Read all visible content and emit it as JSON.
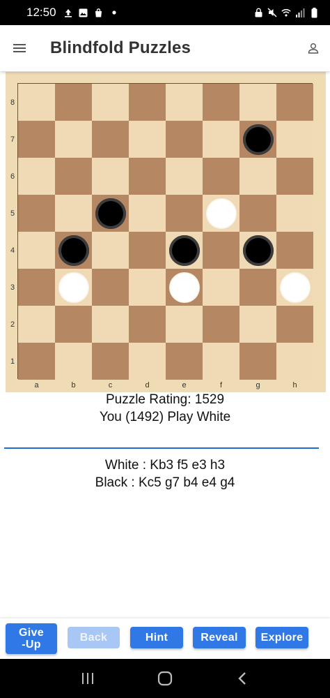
{
  "status_bar": {
    "time": "12:50",
    "left_icons": [
      "upload-icon",
      "image-icon",
      "bag-icon",
      "dot-icon"
    ],
    "right_icons": [
      "lock-icon",
      "mute-icon",
      "wifi-icon",
      "signal-icon",
      "battery-icon"
    ]
  },
  "app_bar": {
    "title": "Blindfold Puzzles",
    "menu_icon": "hamburger-menu-icon",
    "profile_icon": "person-icon"
  },
  "board": {
    "files": [
      "a",
      "b",
      "c",
      "d",
      "e",
      "f",
      "g",
      "h"
    ],
    "ranks": [
      "8",
      "7",
      "6",
      "5",
      "4",
      "3",
      "2",
      "1"
    ],
    "colors": {
      "light": "#f0d9b5",
      "dark": "#b58863",
      "frame": "#efdcb5"
    },
    "pieces": [
      {
        "square": "g7",
        "color": "black"
      },
      {
        "square": "c5",
        "color": "black"
      },
      {
        "square": "f5",
        "color": "white"
      },
      {
        "square": "b4",
        "color": "black"
      },
      {
        "square": "e4",
        "color": "black"
      },
      {
        "square": "g4",
        "color": "black"
      },
      {
        "square": "b3",
        "color": "white"
      },
      {
        "square": "e3",
        "color": "white"
      },
      {
        "square": "h3",
        "color": "white"
      }
    ]
  },
  "info": {
    "rating": "Puzzle Rating: 1529",
    "player": "You (1492) Play White",
    "white_line": "White : Kb3 f5 e3 h3",
    "black_line": "Black : Kc5 g7 b4 e4 g4"
  },
  "toolbar": {
    "give_up": "Give-Up",
    "back": "Back",
    "hint": "Hint",
    "reveal": "Reveal",
    "explore": "Explore",
    "accent": "#2f78e6"
  },
  "nav_bar": {
    "icons": [
      "recent-apps-icon",
      "home-icon",
      "back-icon"
    ]
  }
}
